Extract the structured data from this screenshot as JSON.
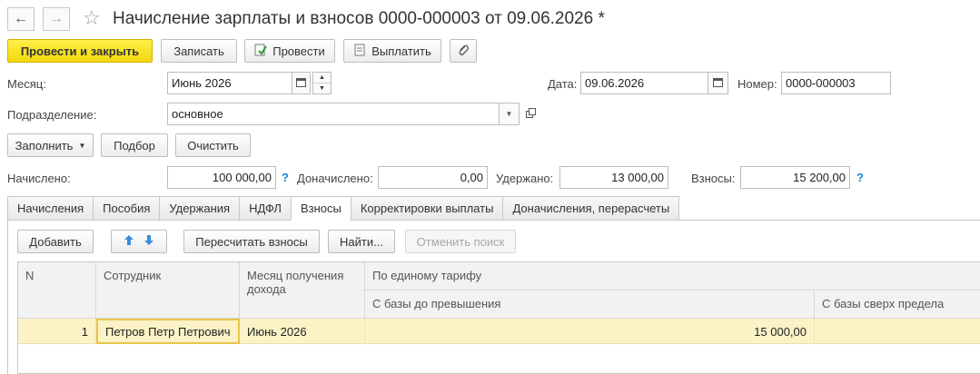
{
  "window": {
    "title": "Начисление зарплаты и взносов 0000-000003 от 09.06.2026 *",
    "back_glyph": "←",
    "forward_glyph": "→",
    "star_glyph": "☆"
  },
  "toolbar": {
    "post_close": "Провести и закрыть",
    "save": "Записать",
    "post": "Провести",
    "pay": "Выплатить",
    "attach_glyph": "📎"
  },
  "header": {
    "month_label": "Месяц:",
    "month_value": "Июнь 2026",
    "date_label": "Дата:",
    "date_value": "09.06.2026",
    "number_label": "Номер:",
    "number_value": "0000-000003",
    "division_label": "Подразделение:",
    "division_value": "основное"
  },
  "actions": {
    "fill": "Заполнить",
    "selection": "Подбор",
    "clear": "Очистить"
  },
  "totals": {
    "accrued_label": "Начислено:",
    "accrued_value": "100 000,00",
    "extra_label": "Доначислено:",
    "extra_value": "0,00",
    "withheld_label": "Удержано:",
    "withheld_value": "13 000,00",
    "contrib_label": "Взносы:",
    "contrib_value": "15 200,00",
    "help_glyph": "?"
  },
  "tabs": [
    {
      "label": "Начисления"
    },
    {
      "label": "Пособия"
    },
    {
      "label": "Удержания"
    },
    {
      "label": "НДФЛ"
    },
    {
      "label": "Взносы"
    },
    {
      "label": "Корректировки выплаты"
    },
    {
      "label": "Доначисления, перерасчеты"
    }
  ],
  "active_tab": "Взносы",
  "table_toolbar": {
    "add": "Добавить",
    "recalc": "Пересчитать взносы",
    "find": "Найти...",
    "cancel_search": "Отменить поиск"
  },
  "table": {
    "headers": {
      "n": "N",
      "employee": "Сотрудник",
      "income_month": "Месяц получения дохода",
      "single_tariff": "По единому тарифу",
      "base_below": "С базы до превышения",
      "base_above": "С базы сверх предела"
    },
    "rows": [
      {
        "n": "1",
        "employee": "Петров Петр Петрович",
        "income_month": "Июнь 2026",
        "base_below": "15 000,00",
        "base_above": ""
      }
    ]
  },
  "colors": {
    "primary_button": "#f2d70b",
    "selected_row": "#fbf2c6",
    "help_blue": "#1a86c8",
    "arrow_blue": "#3a8fd4"
  }
}
